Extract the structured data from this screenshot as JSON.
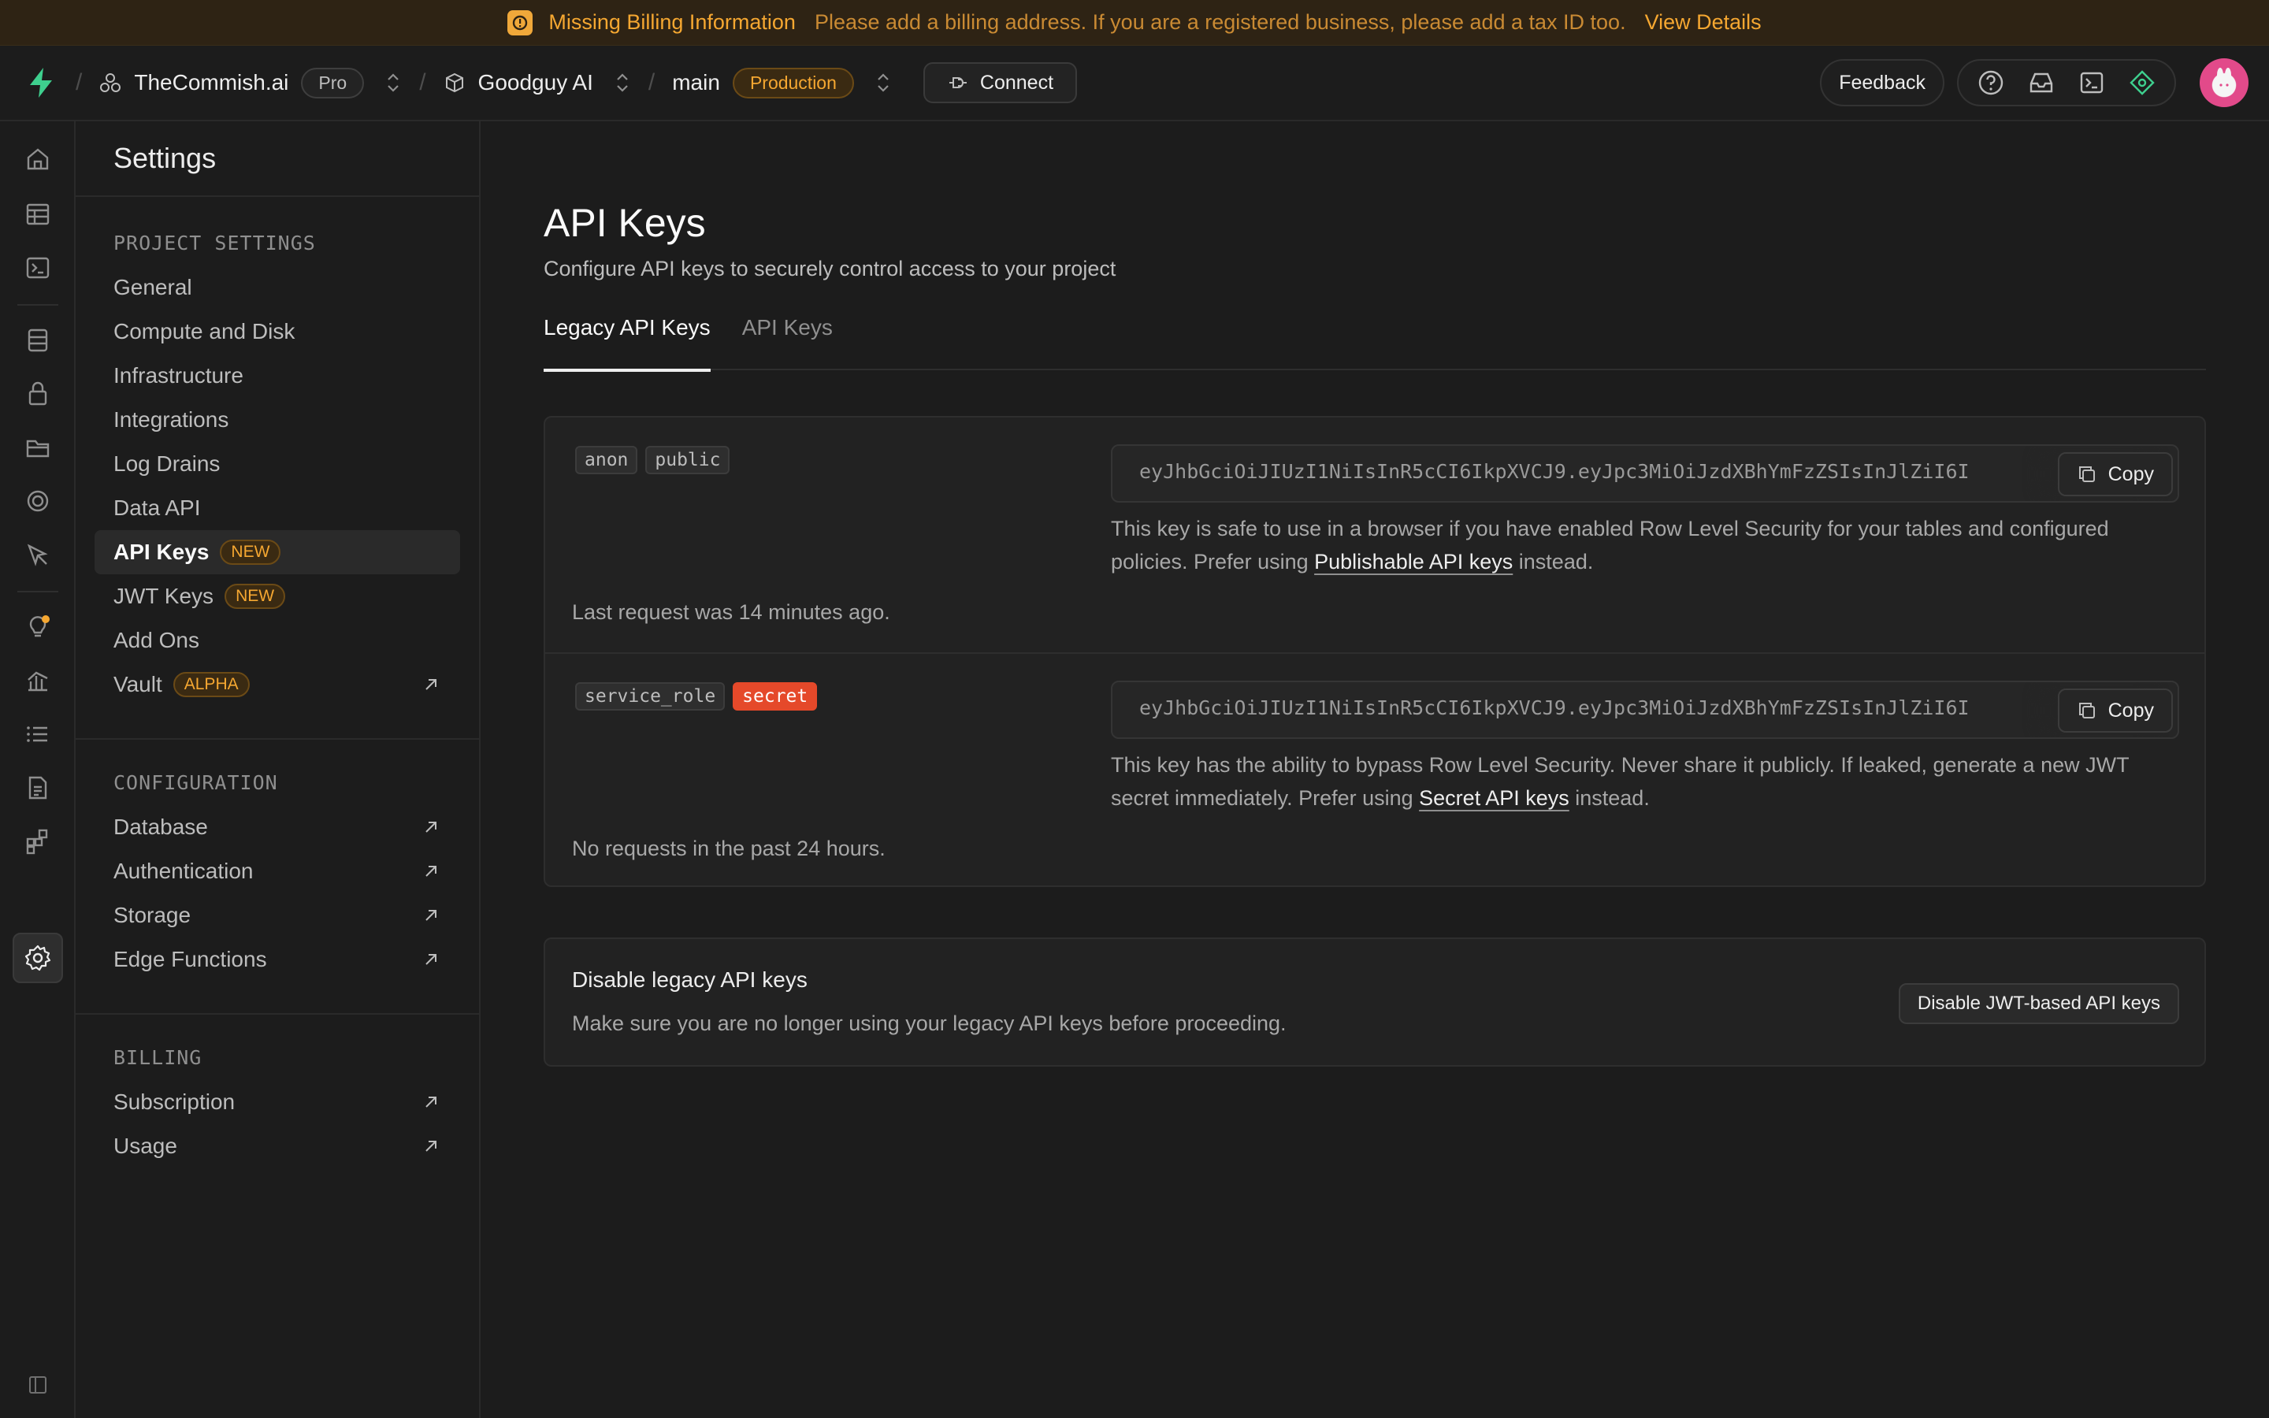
{
  "banner": {
    "title": "Missing Billing Information",
    "message": "Please add a billing address. If you are a registered business, please add a tax ID too.",
    "link": "View Details"
  },
  "topbar": {
    "org": "TheCommish.ai",
    "plan": "Pro",
    "project": "Goodguy AI",
    "branch": "main",
    "env": "Production",
    "connect": "Connect",
    "feedback": "Feedback"
  },
  "sidebar": {
    "title": "Settings",
    "project_settings": {
      "heading": "PROJECT SETTINGS",
      "items": [
        {
          "label": "General"
        },
        {
          "label": "Compute and Disk"
        },
        {
          "label": "Infrastructure"
        },
        {
          "label": "Integrations"
        },
        {
          "label": "Log Drains"
        },
        {
          "label": "Data API"
        },
        {
          "label": "API Keys",
          "tag": "NEW"
        },
        {
          "label": "JWT Keys",
          "tag": "NEW"
        },
        {
          "label": "Add Ons"
        },
        {
          "label": "Vault",
          "tag": "ALPHA"
        }
      ]
    },
    "configuration": {
      "heading": "CONFIGURATION",
      "items": [
        {
          "label": "Database"
        },
        {
          "label": "Authentication"
        },
        {
          "label": "Storage"
        },
        {
          "label": "Edge Functions"
        }
      ]
    },
    "billing": {
      "heading": "BILLING",
      "items": [
        {
          "label": "Subscription"
        },
        {
          "label": "Usage"
        }
      ]
    }
  },
  "main": {
    "title": "API Keys",
    "subtitle": "Configure API keys to securely control access to your project",
    "tabs": [
      {
        "label": "Legacy API Keys"
      },
      {
        "label": "API Keys"
      }
    ],
    "keys": [
      {
        "chips": [
          "anon",
          "public"
        ],
        "value": "eyJhbGciOiJIUzI1NiIsInR5cCI6IkpXVCJ9.eyJpc3MiOiJzdXBhYmFzZSIsInJlZiI6I",
        "copy": "Copy",
        "desc_pre": "This key is safe to use in a browser if you have enabled Row Level Security for your tables and configured policies. Prefer using ",
        "desc_link": "Publishable API keys",
        "desc_post": " instead.",
        "last": "Last request was 14 minutes ago."
      },
      {
        "chips": [
          "service_role",
          "secret"
        ],
        "value": "eyJhbGciOiJIUzI1NiIsInR5cCI6IkpXVCJ9.eyJpc3MiOiJzdXBhYmFzZSIsInJlZiI6I",
        "copy": "Copy",
        "desc_pre": "This key has the ability to bypass Row Level Security. Never share it publicly. If leaked, generate a new JWT secret immediately. Prefer using ",
        "desc_link": "Secret API keys",
        "desc_post": " instead.",
        "last": "No requests in the past 24 hours."
      }
    ],
    "disable": {
      "title": "Disable legacy API keys",
      "desc": "Make sure you are no longer using your legacy API keys before proceeding.",
      "button": "Disable JWT-based API keys"
    }
  },
  "colors": {
    "accent_green": "#3ecf8e",
    "warning": "#f5a731",
    "secret_red": "#e5492a"
  }
}
